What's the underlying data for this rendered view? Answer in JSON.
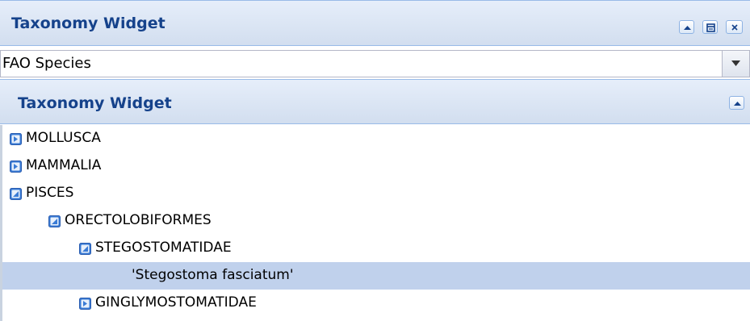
{
  "widget": {
    "title": "Taxonomy Widget",
    "tools": [
      {
        "icon": "collapse-up-icon"
      },
      {
        "icon": "restore-window-icon"
      },
      {
        "icon": "close-icon"
      }
    ]
  },
  "source_select": {
    "value": "FAO Species"
  },
  "inner_panel": {
    "title": "Taxonomy Widget",
    "tool_icon": "collapse-up-icon"
  },
  "tree": {
    "nodes": [
      {
        "label": "MOLLUSCA",
        "state": "collapsed",
        "depth": 0
      },
      {
        "label": "MAMMALIA",
        "state": "collapsed",
        "depth": 0
      },
      {
        "label": "PISCES",
        "state": "expanded",
        "depth": 0
      },
      {
        "label": "ORECTOLOBIFORMES",
        "state": "expanded",
        "depth": 1
      },
      {
        "label": "STEGOSTOMATIDAE",
        "state": "expanded",
        "depth": 2
      },
      {
        "label": "'Stegostoma fasciatum'",
        "state": "leaf",
        "depth": 3,
        "selected": true
      },
      {
        "label": "GINGLYMOSTOMATIDAE",
        "state": "collapsed",
        "depth": 2
      }
    ]
  },
  "colors": {
    "header_text": "#15428b",
    "selected_row": "#c0d1ec",
    "icon_blue": "#3a7bd5"
  }
}
